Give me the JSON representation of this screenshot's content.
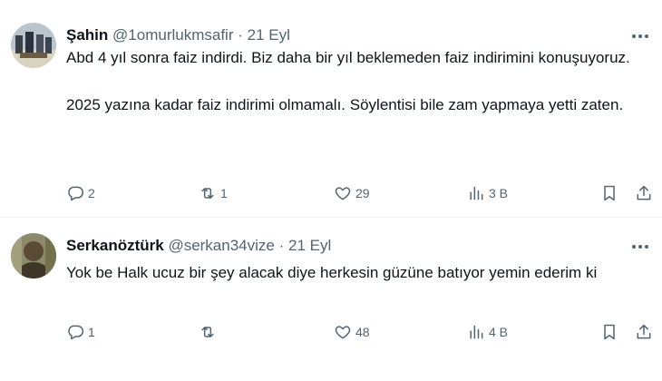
{
  "tweets": [
    {
      "name": "Şahin",
      "handle": "@1omurlukmsafir",
      "separator": "·",
      "date": "21 Eyl",
      "text_p1": "Abd 4 yıl sonra faiz indirdi. Biz daha bir yıl beklemeden faiz indirimini konuşuyoruz.",
      "text_p2": "2025 yazına kadar faiz indirimi olmamalı. Söylentisi bile zam yapmaya yetti zaten.",
      "replies": "2",
      "retweets": "1",
      "likes": "29",
      "views": "3 B"
    },
    {
      "name": "Serkanöztürk",
      "handle": "@serkan34vize",
      "separator": "·",
      "date": "21 Eyl",
      "text_p1": "Yok be Halk ucuz bir şey alacak diye herkesin güzüne batıyor yemin ederim ki",
      "replies": "1",
      "retweets": "",
      "likes": "48",
      "views": "4 B"
    }
  ],
  "icons": {
    "reply": "reply-icon",
    "retweet": "retweet-icon",
    "like": "heart-icon",
    "views": "views-icon",
    "bookmark": "bookmark-icon",
    "share": "share-icon",
    "more": "more-icon"
  },
  "colors": {
    "text": "#0f1419",
    "secondary": "#536471",
    "divider": "#eff3f4"
  }
}
